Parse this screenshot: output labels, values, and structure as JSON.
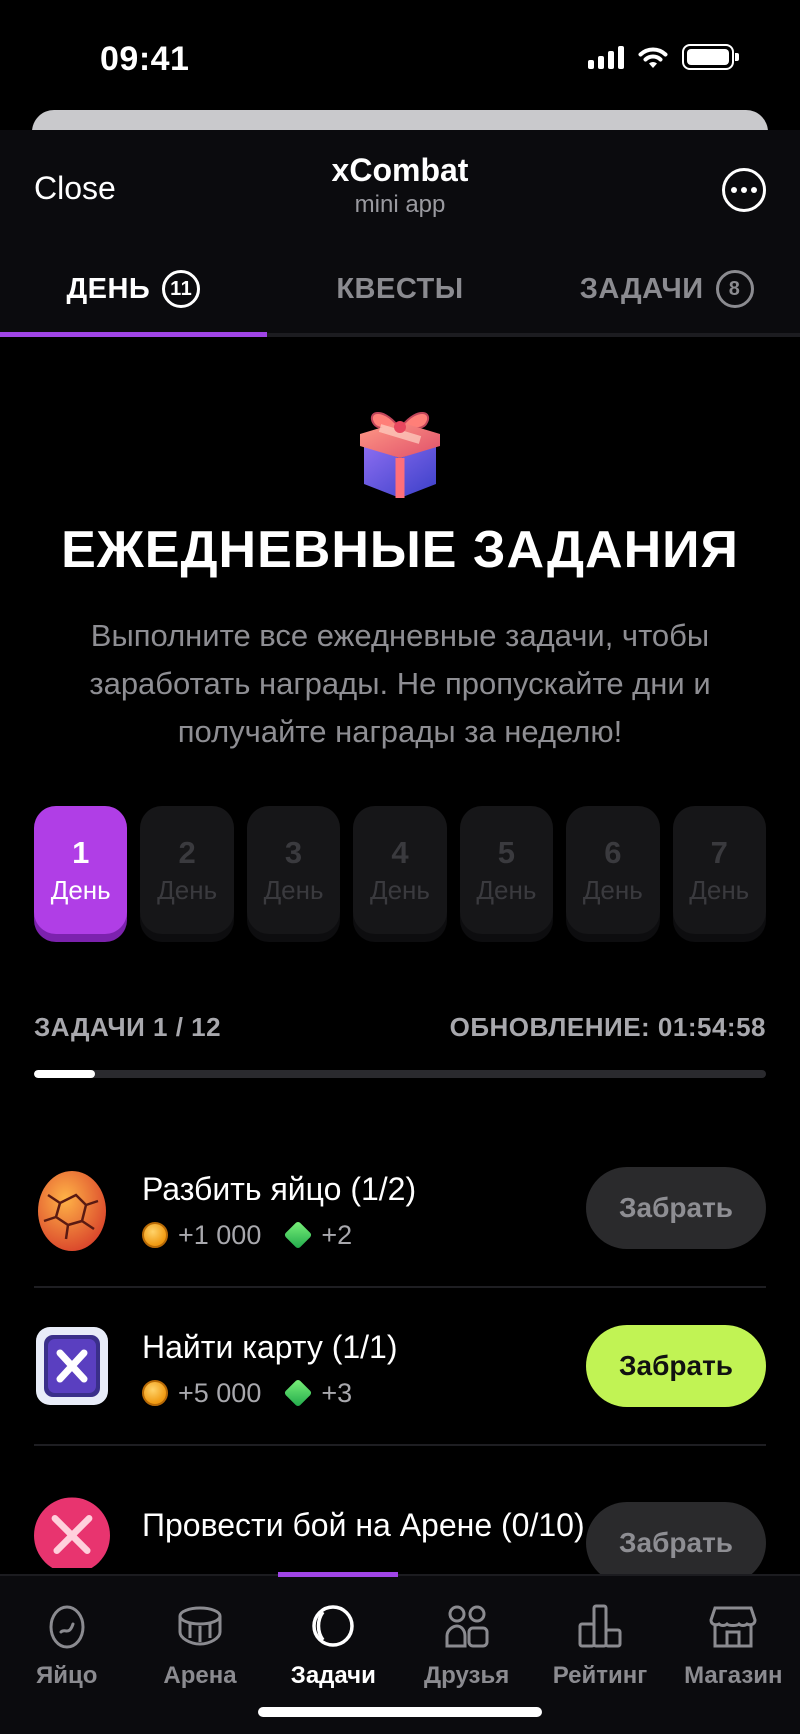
{
  "status": {
    "time": "09:41"
  },
  "header": {
    "close_label": "Close",
    "title": "xCombat",
    "subtitle": "mini app"
  },
  "tabs": [
    {
      "label": "ДЕНЬ",
      "badge": "11",
      "active": true
    },
    {
      "label": "КВЕСТЫ",
      "badge": "",
      "active": false
    },
    {
      "label": "ЗАДАЧИ",
      "badge": "8",
      "active": false
    }
  ],
  "hero": {
    "icon": "gift-icon",
    "title": "ЕЖЕДНЕВНЫЕ ЗАДАНИЯ",
    "description": "Выполните все ежедневные задачи, чтобы заработать награды. Не пропускайте дни и получайте награды за неделю!"
  },
  "days": [
    {
      "num": "1",
      "label": "День",
      "active": true
    },
    {
      "num": "2",
      "label": "День",
      "active": false
    },
    {
      "num": "3",
      "label": "День",
      "active": false
    },
    {
      "num": "4",
      "label": "День",
      "active": false
    },
    {
      "num": "5",
      "label": "День",
      "active": false
    },
    {
      "num": "6",
      "label": "День",
      "active": false
    },
    {
      "num": "7",
      "label": "День",
      "active": false
    }
  ],
  "progress": {
    "tasks_label": "ЗАДАЧИ 1 / 12",
    "update_label": "ОБНОВЛЕНИЕ: 01:54:58",
    "completed": 1,
    "total": 12
  },
  "tasks": [
    {
      "title": "Разбить яйцо (1/2)",
      "coins": "+1 000",
      "gems": "+2",
      "button": "Забрать",
      "ready": false,
      "icon": "egg-icon"
    },
    {
      "title": "Найти карту (1/1)",
      "coins": "+5 000",
      "gems": "+3",
      "button": "Забрать",
      "ready": true,
      "icon": "card-icon"
    },
    {
      "title": "Провести бой на Арене (0/10)",
      "coins": "",
      "gems": "",
      "button": "Забрать",
      "ready": false,
      "icon": "swords-icon"
    }
  ],
  "nav": [
    {
      "label": "Яйцо",
      "icon": "egg-outline-icon",
      "active": false
    },
    {
      "label": "Арена",
      "icon": "arena-icon",
      "active": false
    },
    {
      "label": "Задачи",
      "icon": "tasks-icon",
      "active": true
    },
    {
      "label": "Друзья",
      "icon": "friends-icon",
      "active": false
    },
    {
      "label": "Рейтинг",
      "icon": "rating-icon",
      "active": false
    },
    {
      "label": "Магазин",
      "icon": "shop-icon",
      "active": false
    }
  ],
  "colors": {
    "accent": "#a045e6",
    "day_active": "#b03ee6",
    "claim_ready": "#c1f354"
  }
}
